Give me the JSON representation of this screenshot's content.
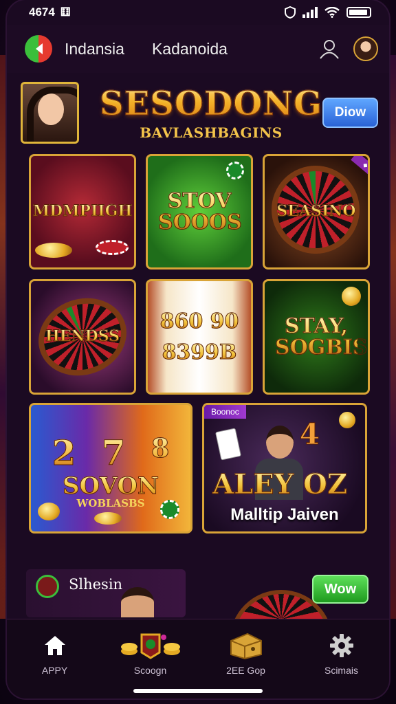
{
  "status_bar": {
    "time": "4674",
    "app_badge": "⚅"
  },
  "nav": {
    "links": [
      "Indansia",
      "Kadanoida"
    ],
    "user_icon": "user-icon",
    "avatar_icon": "avatar"
  },
  "hero": {
    "title": "SESODONG",
    "subtitle": "BAVLASHBAGINS",
    "button_label": "Diow"
  },
  "games": [
    {
      "label": "MDMPIIGH",
      "theme": "red"
    },
    {
      "label": "STOV SOOOS",
      "theme": "green"
    },
    {
      "label": "SEASINO",
      "theme": "roulette"
    },
    {
      "label": "HENDSS",
      "theme": "purple"
    },
    {
      "label_top": "860 90",
      "label_bottom": "8399B",
      "theme": "slot-reel"
    },
    {
      "label": "STAY, SOGBIS",
      "theme": "green-dark"
    }
  ],
  "featured": [
    {
      "reel_numbers": [
        "2",
        "7",
        "8"
      ],
      "title": "SOVON",
      "subtitle": "WOBLASBS"
    },
    {
      "corner_tag": "Boonoc",
      "title": "ALEY OZ",
      "caption": "Malltip Jaiven",
      "big_digit": "4"
    }
  ],
  "promo": {
    "text": "Slhesin",
    "button_label": "Wow"
  },
  "tabs": [
    {
      "label": "APPY",
      "icon": "home-icon"
    },
    {
      "label": "Scoogn",
      "icon": "slot-chips-icon"
    },
    {
      "label": "2EE Gop",
      "icon": "treasure-icon"
    },
    {
      "label": "Scimais",
      "icon": "gear-icon"
    }
  ],
  "colors": {
    "background": "#1b0a22",
    "gold_border": "#d9a437",
    "blue_button": "#2a62d6",
    "green_button": "#1e9a1e"
  }
}
